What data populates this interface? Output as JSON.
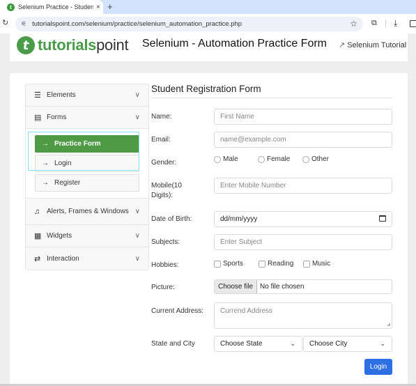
{
  "browser": {
    "tab_title": "Selenium Practice - Student R",
    "tab_close": "×",
    "new_tab": "+",
    "url": "tutorialspoint.com/selenium/practice/selenium_automation_practice.php",
    "icons": {
      "reload": "reload-icon",
      "site_info": "tune-icon",
      "bookmark": "star-icon",
      "extensions": "puzzle-icon",
      "downloads": "download-icon",
      "side_panel": "side-panel-icon"
    }
  },
  "header": {
    "logo_bold": "tutorials",
    "logo_light": "point",
    "logo_mark": "t",
    "title": "Selenium - Automation Practice Form",
    "tutorial_link": "Selenium Tutorial"
  },
  "sidebar": {
    "sections": [
      {
        "label": "Elements",
        "icon": "hamburger-icon",
        "glyph": "☰"
      },
      {
        "label": "Forms",
        "icon": "list-icon",
        "glyph": "▤"
      },
      {
        "label": "Alerts, Frames & Windows",
        "icon": "bell-icon",
        "glyph": "🔔"
      },
      {
        "label": "Widgets",
        "icon": "widgets-icon",
        "glyph": "▦"
      },
      {
        "label": "Interaction",
        "icon": "swap-icon",
        "glyph": "⇄"
      }
    ],
    "forms_items": [
      {
        "label": "Practice Form",
        "active": true
      },
      {
        "label": "Login",
        "active": false
      },
      {
        "label": "Register",
        "active": false
      }
    ],
    "arrow": "→",
    "chevron": "∨"
  },
  "form": {
    "title": "Student Registration Form",
    "name": {
      "label": "Name:",
      "placeholder": "First Name"
    },
    "email": {
      "label": "Email:",
      "placeholder": "name@example.com"
    },
    "gender": {
      "label": "Gender:",
      "options": [
        "Male",
        "Female",
        "Other"
      ]
    },
    "mobile": {
      "label_line1": "Mobile(10",
      "label_line2": "Digits):",
      "placeholder": "Enter Mobile Number"
    },
    "dob": {
      "label": "Date of Birth:",
      "value": "dd/mm/yyyy"
    },
    "subjects": {
      "label": "Subjects:",
      "placeholder": "Enter Subject"
    },
    "hobbies": {
      "label": "Hobbies:",
      "options": [
        "Sports",
        "Reading",
        "Music"
      ]
    },
    "picture": {
      "label": "Picture:",
      "button": "Choose file",
      "status": "No file chosen"
    },
    "address": {
      "label": "Current Address:",
      "placeholder": "Currend Address"
    },
    "state_city": {
      "label": "State and City",
      "state": "Choose State",
      "city": "Choose City"
    },
    "submit": "Login"
  }
}
